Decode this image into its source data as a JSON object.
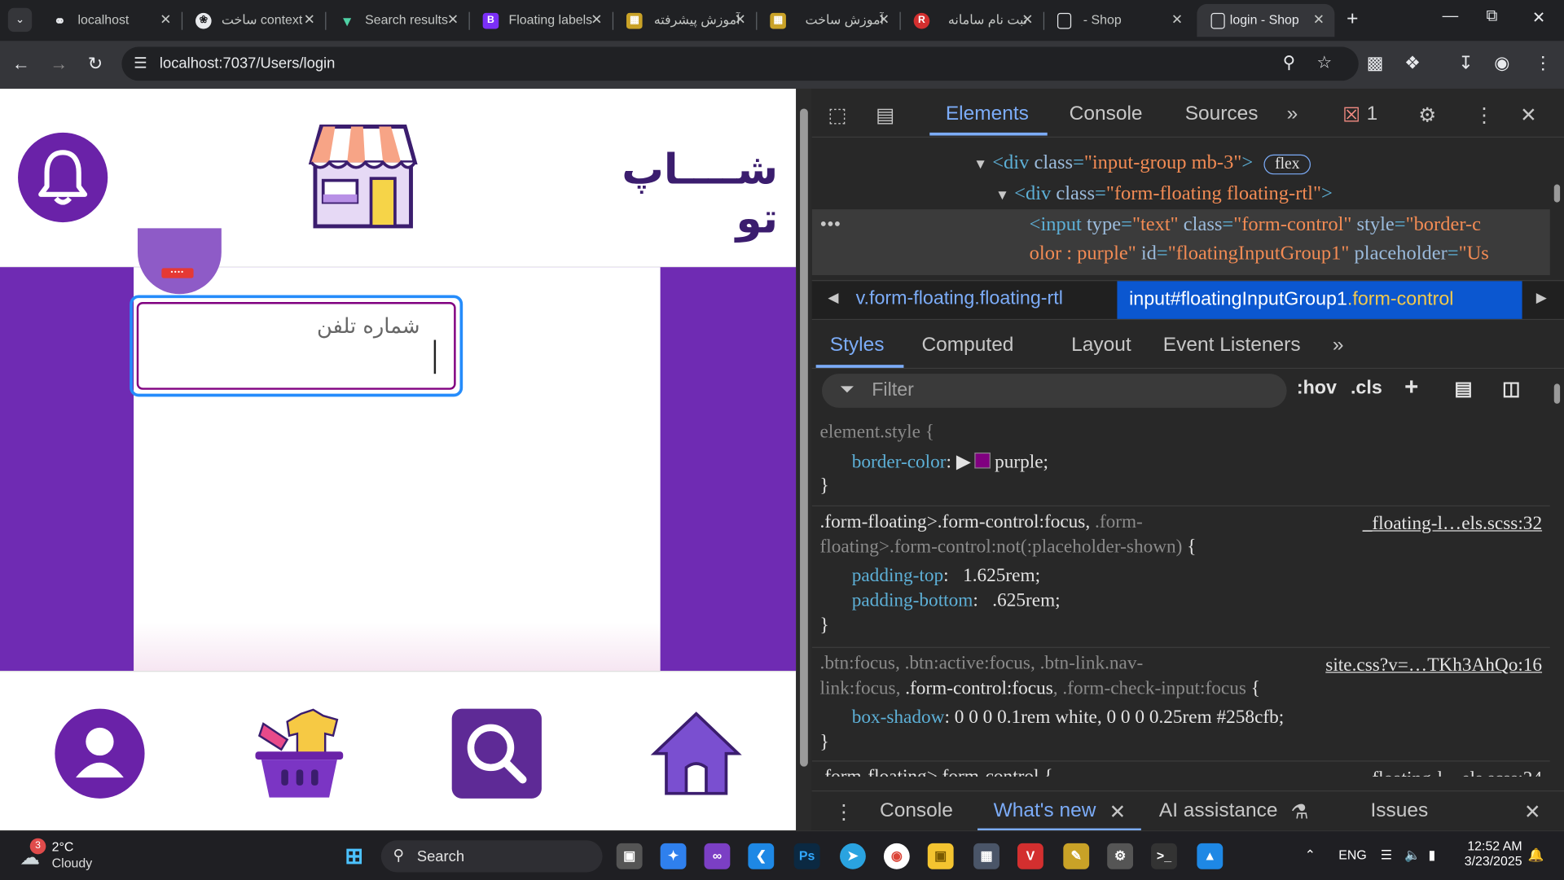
{
  "browser": {
    "tabs": [
      {
        "title": "localhost",
        "icon": "globe-icon",
        "active": false
      },
      {
        "title": "ساخت context",
        "icon": "chatgpt-icon",
        "active": false
      },
      {
        "title": "Search results",
        "icon": "vuetify-icon",
        "active": false
      },
      {
        "title": "Floating labels",
        "icon": "bootstrap-icon",
        "active": false
      },
      {
        "title": "آموزش پیشرفته",
        "icon": "course-icon",
        "active": false
      },
      {
        "title": "آموزش ساخت",
        "icon": "course-icon",
        "active": false
      },
      {
        "title": "ثبت نام سامانه",
        "icon": "red-logo-icon",
        "active": false
      },
      {
        "title": "- Shop",
        "icon": "page-icon",
        "active": false
      },
      {
        "title": "login - Shop",
        "icon": "page-icon",
        "active": true
      }
    ],
    "url": "localhost:7037/Users/login"
  },
  "page": {
    "brand_title": "شــــاپ تو",
    "phone_placeholder": "شماره تلفن",
    "nav_icons": [
      "user-icon",
      "shopping-basket-icon",
      "search-icon",
      "home-icon"
    ]
  },
  "devtools": {
    "tabs": [
      "Elements",
      "Console",
      "Sources"
    ],
    "error_count": "1",
    "dom_lines": [
      {
        "open": "<div ",
        "attr": "class",
        "val": "\"input-group mb-3\"",
        "close": ">",
        "pill": "flex"
      },
      {
        "open": "<div ",
        "attr": "class",
        "val": "\"form-floating floating-rtl\"",
        "close": ">",
        "pill": ""
      },
      {
        "open": "<input ",
        "attr": "type",
        "val": "\"text\"",
        "rest1attr": "class",
        "rest1val": "\"form-control\"",
        "rest2attr": "style",
        "rest2val": "\"border-c"
      },
      {
        "cont": "olor : purple\"",
        "attr": "id",
        "val": "\"floatingInputGroup1\"",
        "rest1attr": "placeholder",
        "rest1val": "\"Us"
      }
    ],
    "breadcrumb_prev": "v.form-floating.floating-rtl",
    "breadcrumb_current_tag": "input",
    "breadcrumb_current_id": "#floatingInputGroup1",
    "breadcrumb_current_class": ".form-control",
    "subtabs": [
      "Styles",
      "Computed",
      "Layout",
      "Event Listeners"
    ],
    "filter_placeholder": "Filter",
    "filter_buttons": [
      ":hov",
      ".cls"
    ],
    "rules": [
      {
        "selector": "element.style {",
        "decls": [
          {
            "prop": "border-color",
            "val": "purple;"
          }
        ],
        "source": ""
      },
      {
        "selector": ".form-floating>.form-control:focus,",
        "selector_dim": ".form-",
        "selector2_dim": "floating>.form-control:not(:placeholder-shown)",
        "selector2_tail": " {",
        "decls": [
          {
            "prop": "padding-top",
            "val": "1.625rem;"
          },
          {
            "prop": "padding-bottom",
            "val": ".625rem;"
          }
        ],
        "source": "_floating-l…els.scss:32"
      },
      {
        "selector_dim": ".btn:focus, .btn:active:focus, .btn-link.nav-",
        "selector2_dim": "link:focus,",
        "selector2_tail": ".form-control:focus",
        "selector2_dim2": ", .form-check-input:focus",
        "decls": [
          {
            "prop": "box-shadow",
            "val": "0 0 0 0.1rem white, 0 0 0 0.25rem #258cfb;"
          }
        ],
        "source": "site.css?v=…TKh3AhQo:16"
      },
      {
        "selector": ".form-floating>.form-control {",
        "source": "_floating-l…els.scss:24"
      }
    ],
    "drawer_tabs": [
      "Console",
      "What's new",
      "AI assistance",
      "Issues"
    ]
  },
  "taskbar": {
    "weather_temp": "2°C",
    "weather_cond": "Cloudy",
    "weather_badge": "3",
    "search_label": "Search",
    "lang": "ENG",
    "time": "12:52 AM",
    "date": "3/23/2025"
  },
  "colors": {
    "purple": "#6f2bb3",
    "focus_blue": "#258cfb",
    "input_border": "#800080"
  }
}
